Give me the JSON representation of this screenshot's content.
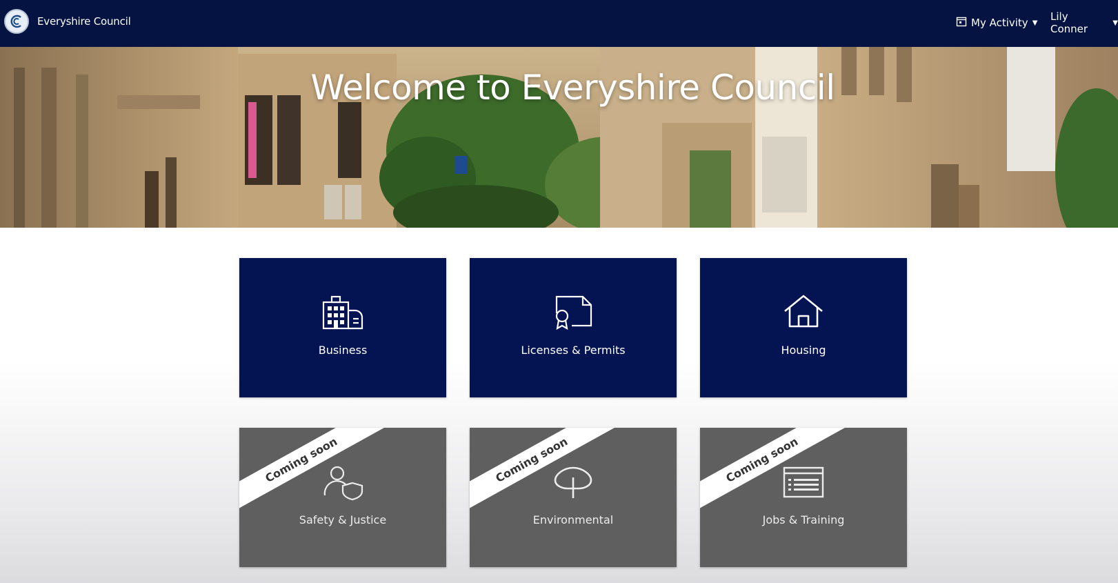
{
  "header": {
    "brand": "Everyshire Council",
    "logo_icon": "council-logo-icon",
    "activity_label": "My Activity",
    "activity_icon": "calendar-icon",
    "user_name": "Lily Conner",
    "bar_color": "#041342"
  },
  "hero": {
    "title": "Welcome to Everyshire Council"
  },
  "tiles": [
    {
      "label": "Business",
      "icon": "building-icon",
      "coming_soon": false
    },
    {
      "label": "Licenses & Permits",
      "icon": "certificate-icon",
      "coming_soon": false
    },
    {
      "label": "Housing",
      "icon": "house-icon",
      "coming_soon": false
    },
    {
      "label": "Safety & Justice",
      "icon": "person-shield-icon",
      "coming_soon": true
    },
    {
      "label": "Environmental",
      "icon": "tree-icon",
      "coming_soon": true
    },
    {
      "label": "Jobs & Training",
      "icon": "job-listing-icon",
      "coming_soon": true
    }
  ],
  "ribbon_text": "Coming soon",
  "colors": {
    "tile_active": "#041352",
    "tile_coming_soon": "#5f5f5f"
  }
}
